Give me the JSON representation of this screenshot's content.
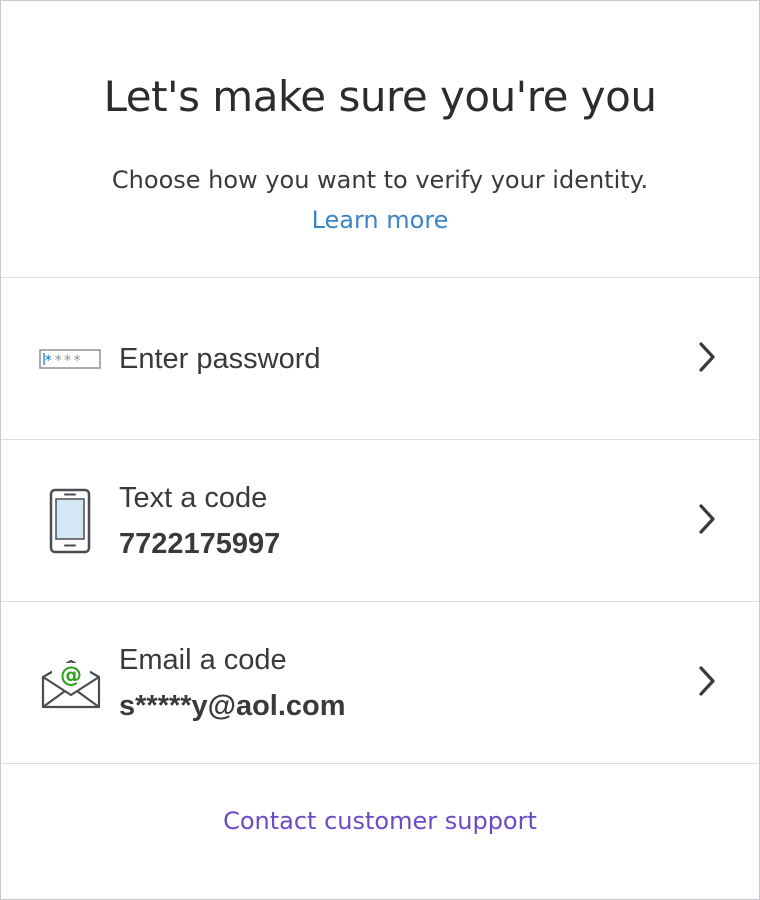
{
  "header": {
    "title": "Let's make sure you're you",
    "subtitle": "Choose how you want to verify your identity.",
    "learn_more": "Learn more"
  },
  "options": [
    {
      "label": "Enter password",
      "detail": "",
      "icon": "password-field-icon",
      "icon_text": "****"
    },
    {
      "label": "Text a code",
      "detail": "7722175997",
      "icon": "mobile-phone-icon"
    },
    {
      "label": "Email a code",
      "detail": "s*****y@aol.com",
      "icon": "email-envelope-icon",
      "icon_text": "@"
    }
  ],
  "footer": {
    "support_link": "Contact customer support"
  },
  "colors": {
    "link_blue": "#3b85c4",
    "support_purple": "#6b4bc6",
    "email_at_green": "#2ca01c",
    "password_star_blue": "#0077c5",
    "text": "#393a3d",
    "divider": "#dcdde0"
  }
}
